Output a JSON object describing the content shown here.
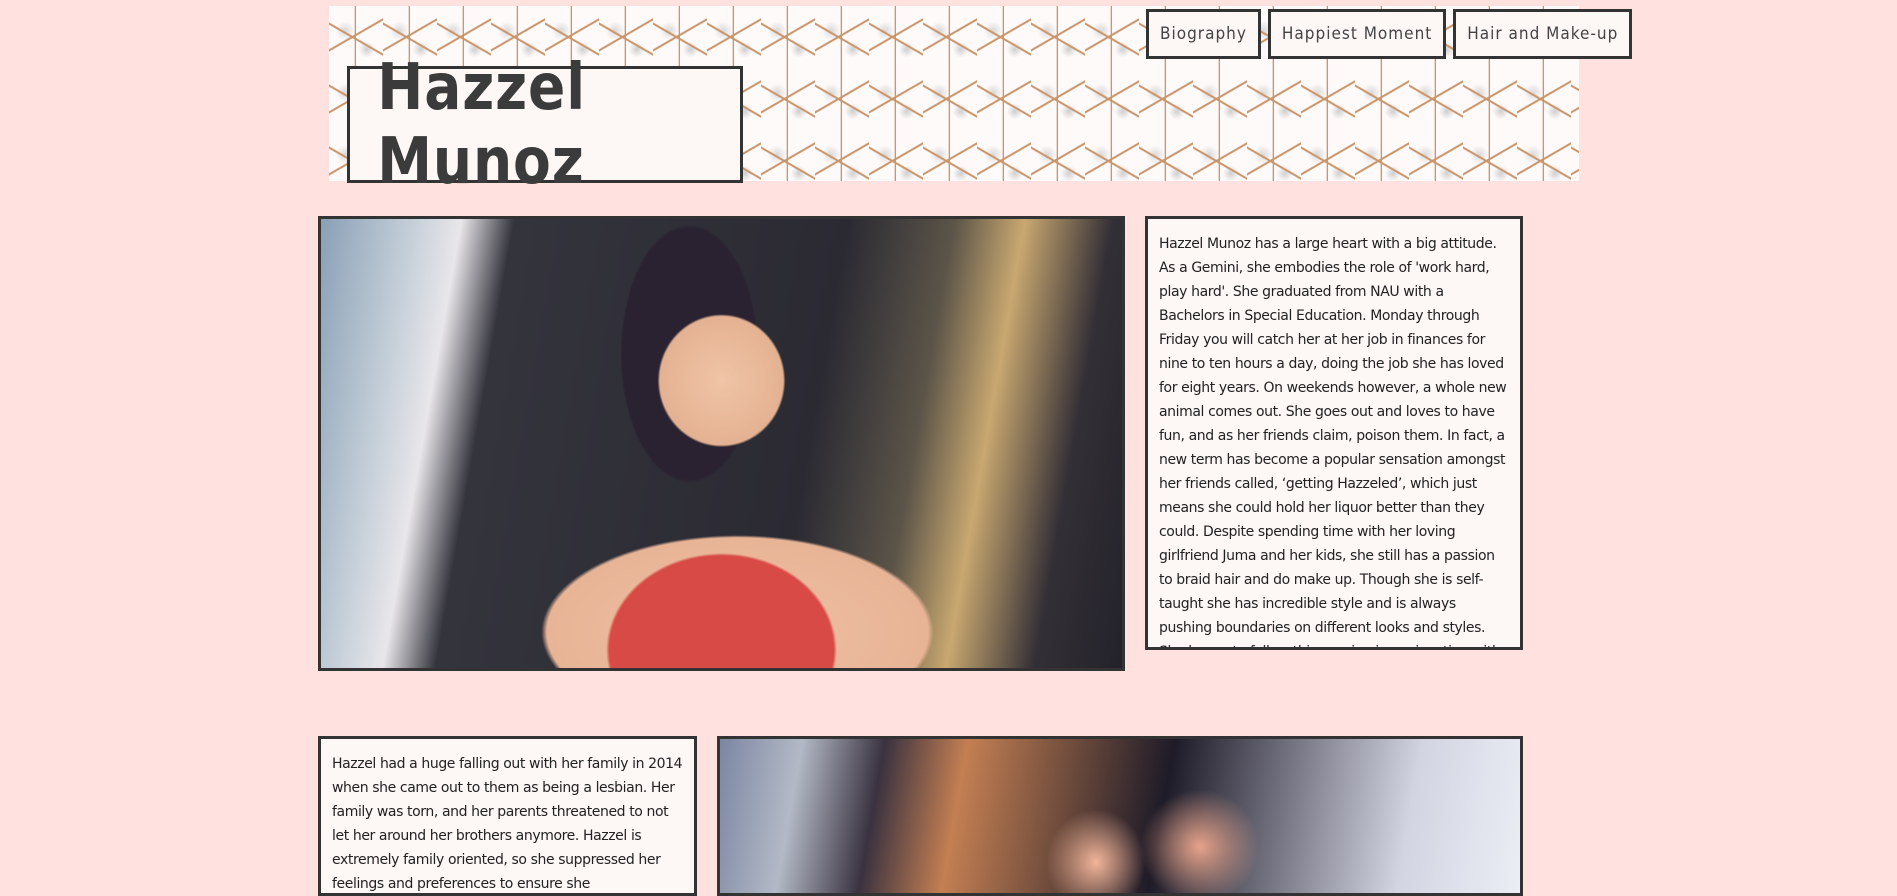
{
  "header": {
    "title": "Hazzel Munoz"
  },
  "nav": {
    "items": [
      {
        "label": "Biography"
      },
      {
        "label": "Happiest Moment"
      },
      {
        "label": "Hair and Make-up"
      }
    ]
  },
  "sections": {
    "bio_main": "Hazzel Munoz has a large heart with a big attitude. As a Gemini, she embodies the role of 'work hard, play hard'. She graduated from NAU with a Bachelors in Special Education. Monday through Friday you will catch her at her job in finances for nine to ten hours a day, doing the job she has loved for eight years. On weekends however, a whole new animal comes out. She goes out and loves to have fun, and as her friends claim, poison them. In fact, a new term has become a popular sensation amongst her friends called, ‘getting Hazzeled’, which just means she could hold her liquor better than they could. Despite spending time with her loving girlfriend Juma and her kids, she still has a passion to braid hair and do make up. Though she is self-taught she has incredible style and is always pushing boundaries on different looks and styles. She hopes to follow this passion in conjunction with her job, and is always looking for new models.",
    "bio_family": "Hazzel had a huge falling out with her family in 2014 when she came out to them as being a lesbian. Her family was torn, and her parents threatened to not let her around her brothers anymore. Hazzel is extremely family oriented, so she suppressed her feelings and preferences to ensure she"
  }
}
